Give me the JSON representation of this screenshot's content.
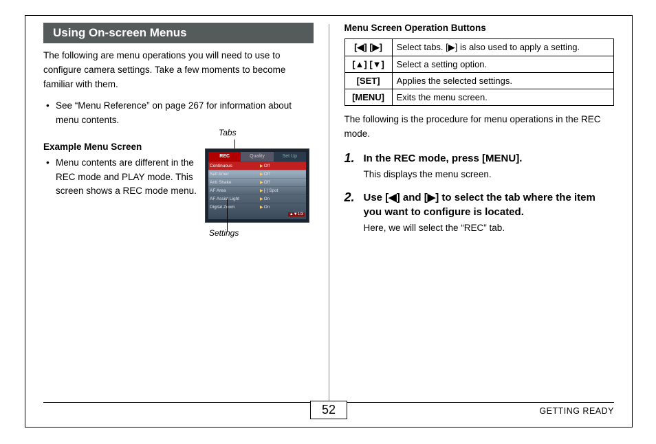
{
  "page_number": "52",
  "footer_section": "GETTING READY",
  "left": {
    "title": "Using On-screen Menus",
    "intro": "The following are menu operations you will need to use to configure camera settings. Take a few moments to become familiar with them.",
    "see_ref": "See “Menu Reference” on page 267 for information about menu contents.",
    "example_head": "Example Menu Screen",
    "example_text": "Menu contents are different in the REC mode and PLAY mode. This screen shows a REC mode menu.",
    "label_tabs": "Tabs",
    "label_settings": "Settings",
    "screen": {
      "tabs": [
        "REC",
        "Quality",
        "Set Up"
      ],
      "rows": [
        {
          "label": "Continuous",
          "value": "Off"
        },
        {
          "label": "Self-timer",
          "value": "Off"
        },
        {
          "label": "Anti Shake",
          "value": "Off"
        },
        {
          "label": "AF Area",
          "value": "[·] Spot"
        },
        {
          "label": "AF Assist Light",
          "value": "On"
        },
        {
          "label": "Digital Zoom",
          "value": "On"
        }
      ],
      "page_indicator": "▲▼1/3"
    }
  },
  "right": {
    "ops_head": "Menu Screen Operation Buttons",
    "ops": [
      {
        "key": "[◀] [▶]",
        "desc": "Select tabs. [▶] is also used to apply a setting."
      },
      {
        "key": "[▲] [▼]",
        "desc": "Select a setting option."
      },
      {
        "key": "[SET]",
        "desc": "Applies the selected settings."
      },
      {
        "key": "[MENU]",
        "desc": "Exits the menu screen."
      }
    ],
    "after_table": "The following is the procedure for menu operations in the REC mode.",
    "steps": [
      {
        "num": "1.",
        "title": "In the REC mode, press [MENU].",
        "sub": "This displays the menu screen."
      },
      {
        "num": "2.",
        "title": "Use [◀] and [▶] to select the tab where the item you want to configure is located.",
        "sub": "Here, we will select the “REC” tab."
      }
    ]
  }
}
